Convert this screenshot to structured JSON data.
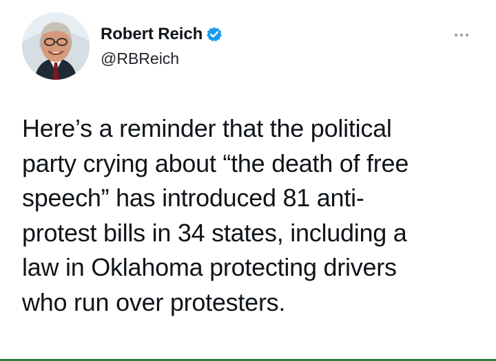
{
  "author": {
    "display_name": "Robert Reich",
    "handle": "@RBReich",
    "verified_icon": "verified-badge",
    "avatar": "profile-avatar"
  },
  "actions": {
    "more_icon": "more-options-icon"
  },
  "tweet": {
    "lines": [
      "Here’s a reminder that the political",
      "party crying about “the death of free",
      "speech” has introduced 81 anti-",
      "protest bills in 34 states, including a",
      "law in Oklahoma protecting drivers",
      "who run over protesters."
    ]
  },
  "colors": {
    "verified": "#1d9bf0",
    "text": "#0f1419",
    "muted": "#8b98a5",
    "bottom_rule": "#2f7d3b"
  }
}
